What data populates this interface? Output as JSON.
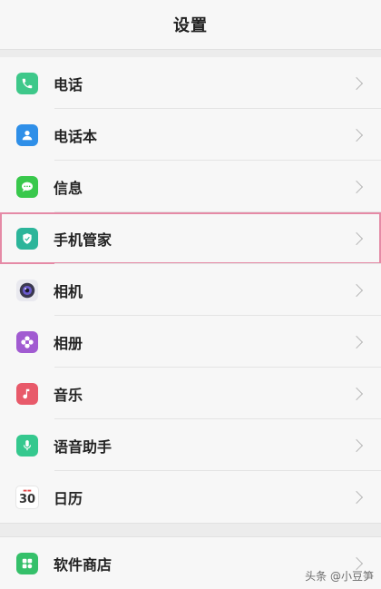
{
  "header": {
    "title": "设置"
  },
  "items": [
    {
      "label": "电话",
      "icon": "phone-icon",
      "color": "#3ec88a"
    },
    {
      "label": "电话本",
      "icon": "contacts-icon",
      "color": "#2f8fe8"
    },
    {
      "label": "信息",
      "icon": "message-icon",
      "color": "#39c84c"
    },
    {
      "label": "手机管家",
      "icon": "shield-icon",
      "color": "#2cb59a"
    },
    {
      "label": "相机",
      "icon": "camera-icon",
      "color": "#6a5acd"
    },
    {
      "label": "相册",
      "icon": "album-icon",
      "color": "#a15bd1"
    },
    {
      "label": "音乐",
      "icon": "music-icon",
      "color": "#e85a6a"
    },
    {
      "label": "语音助手",
      "icon": "microphone-icon",
      "color": "#35c88e"
    },
    {
      "label": "日历",
      "icon": "calendar-icon",
      "color": "#e54b4b"
    }
  ],
  "items2": [
    {
      "label": "软件商店",
      "icon": "app-store-icon",
      "color": "#35c06a"
    }
  ],
  "calendar_icon": {
    "day": "30"
  },
  "watermark": "头条 @小豆笋"
}
